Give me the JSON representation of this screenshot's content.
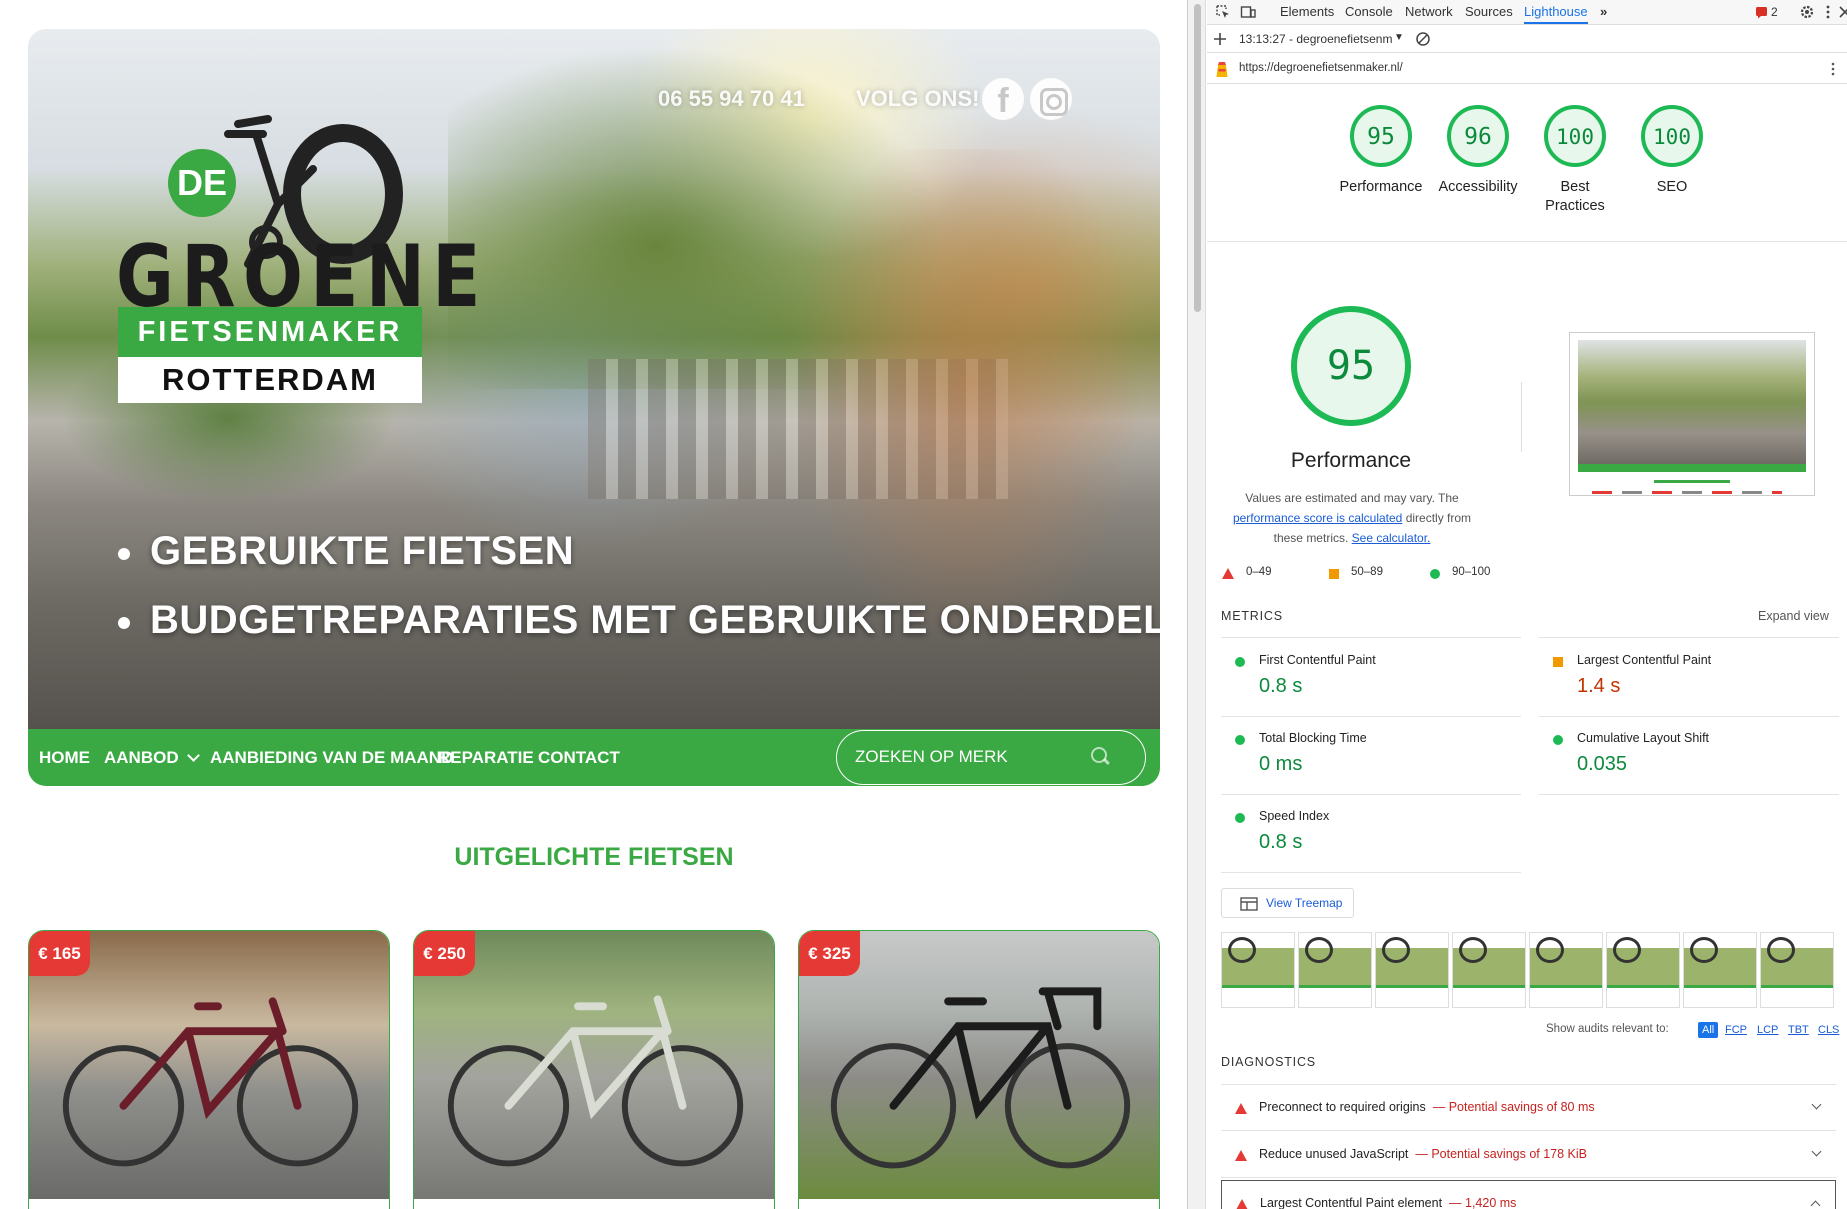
{
  "site": {
    "phone": "06 55 94 70 41",
    "follow": "VOLG ONS!",
    "logo": {
      "de": "DE",
      "groene": "GROENE",
      "fietsenmaker": "FIETSENMAKER",
      "city": "ROTTERDAM"
    },
    "hero_bullets": [
      "GEBRUIKTE FIETSEN",
      "BUDGETREPARATIES MET GEBRUIKTE ONDERDELEN"
    ],
    "nav": {
      "home": "HOME",
      "aanbod": "AANBOD",
      "aanbieding": "AANBIEDING VAN DE MAAND",
      "reparatie": "REPARATIE",
      "contact": "CONTACT",
      "search_placeholder": "ZOEKEN OP MERK"
    },
    "featured_title": "UITGELICHTE FIETSEN",
    "products": [
      {
        "price": "€ 165",
        "frame_color": "#6b1e2a"
      },
      {
        "price": "€ 250",
        "frame_color": "#d8dcd2"
      },
      {
        "price": "€ 325",
        "frame_color": "#1c1c1c"
      }
    ]
  },
  "devtools": {
    "tabs": [
      "Elements",
      "Console",
      "Network",
      "Sources",
      "Lighthouse"
    ],
    "active_tab": "Lighthouse",
    "issues_count": "2",
    "report_label": "13:13:27 - degroenefietsenm",
    "url": "https://degroenefietsenmaker.nl/",
    "scores": [
      {
        "value": "95",
        "label": "Performance"
      },
      {
        "value": "96",
        "label": "Accessibility"
      },
      {
        "value": "100",
        "label": "Best Practices"
      },
      {
        "value": "100",
        "label": "SEO"
      }
    ],
    "perf": {
      "score": "95",
      "title": "Performance",
      "desc_1": "Values are estimated and may vary. The ",
      "desc_link_1": "performance score is calculated",
      "desc_2": " directly from these metrics. ",
      "desc_link_2": "See calculator.",
      "legend": [
        "0–49",
        "50–89",
        "90–100"
      ]
    },
    "metrics_heading": "METRICS",
    "expand_view": "Expand view",
    "metrics": [
      {
        "name": "First Contentful Paint",
        "value": "0.8 s",
        "status": "pass"
      },
      {
        "name": "Largest Contentful Paint",
        "value": "1.4 s",
        "status": "average"
      },
      {
        "name": "Total Blocking Time",
        "value": "0 ms",
        "status": "pass"
      },
      {
        "name": "Cumulative Layout Shift",
        "value": "0.035",
        "status": "pass"
      },
      {
        "name": "Speed Index",
        "value": "0.8 s",
        "status": "pass"
      }
    ],
    "view_treemap": "View Treemap",
    "show_audits": "Show audits relevant to:",
    "audit_filters": [
      "All",
      "FCP",
      "LCP",
      "TBT",
      "CLS"
    ],
    "diagnostics_heading": "DIAGNOSTICS",
    "diagnostics": [
      {
        "title": "Preconnect to required origins",
        "savings": "Potential savings of 80 ms"
      },
      {
        "title": "Reduce unused JavaScript",
        "savings": "Potential savings of 178 KiB"
      },
      {
        "title": "Largest Contentful Paint element",
        "savings": "1,420 ms"
      }
    ],
    "colors": {
      "pass": "#0c8a3c",
      "average": "#c33300",
      "gauge_fill": "#e8f7ec",
      "gauge_ring": "#1db954"
    }
  }
}
